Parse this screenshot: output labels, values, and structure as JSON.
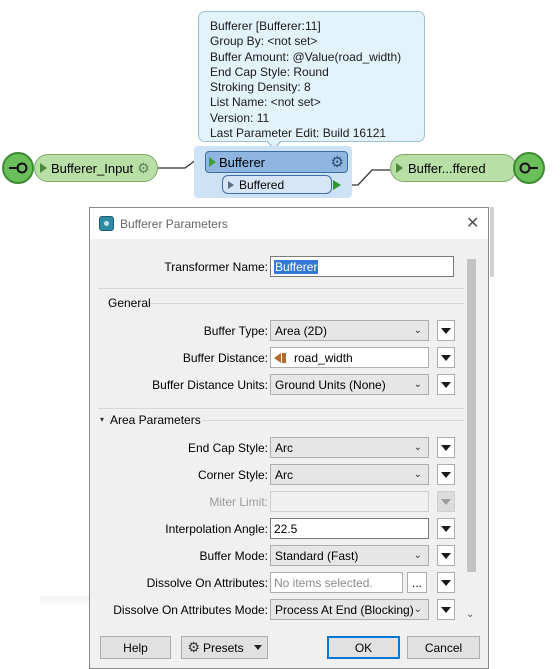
{
  "tooltip": {
    "lines": [
      "Bufferer [Bufferer:11]",
      "Group By: <not set>",
      "Buffer Amount: @Value(road_width)",
      "End Cap Style: Round",
      "Stroking Density: 8",
      "List Name: <not set>",
      "Version: 11",
      "Last Parameter Edit: Build 16121"
    ]
  },
  "workflow": {
    "input_node_label": "Bufferer_Input",
    "transformer_label": "Bufferer",
    "output_port_label": "Buffered",
    "output_node_label": "Buffer...ffered",
    "colors": {
      "feature_node": "#b8e0a6",
      "transformer": "#8fb6e0",
      "selection": "#cde3f5"
    }
  },
  "dialog": {
    "title": "Bufferer Parameters",
    "close_glyph": "✕",
    "transformer_name_label": "Transformer Name:",
    "transformer_name_value": "Bufferer",
    "general": {
      "title": "General",
      "buffer_type_label": "Buffer Type:",
      "buffer_type_value": "Area (2D)",
      "buffer_distance_label": "Buffer Distance:",
      "buffer_distance_value": "road_width",
      "buffer_distance_units_label": "Buffer Distance Units:",
      "buffer_distance_units_value": "Ground Units (None)"
    },
    "area": {
      "title": "Area Parameters",
      "end_cap_style_label": "End Cap Style:",
      "end_cap_style_value": "Arc",
      "corner_style_label": "Corner Style:",
      "corner_style_value": "Arc",
      "miter_limit_label": "Miter Limit:",
      "miter_limit_value": "",
      "interpolation_angle_label": "Interpolation Angle:",
      "interpolation_angle_value": "22.5",
      "buffer_mode_label": "Buffer Mode:",
      "buffer_mode_value": "Standard (Fast)",
      "dissolve_on_attributes_label": "Dissolve On Attributes:",
      "dissolve_on_attributes_placeholder": "No items selected.",
      "dissolve_on_attributes_button": "...",
      "dissolve_mode_label": "Dissolve On Attributes Mode:",
      "dissolve_mode_value": "Process At End (Blocking)"
    },
    "buttons": {
      "help": "Help",
      "presets": "Presets",
      "ok": "OK",
      "cancel": "Cancel"
    }
  }
}
